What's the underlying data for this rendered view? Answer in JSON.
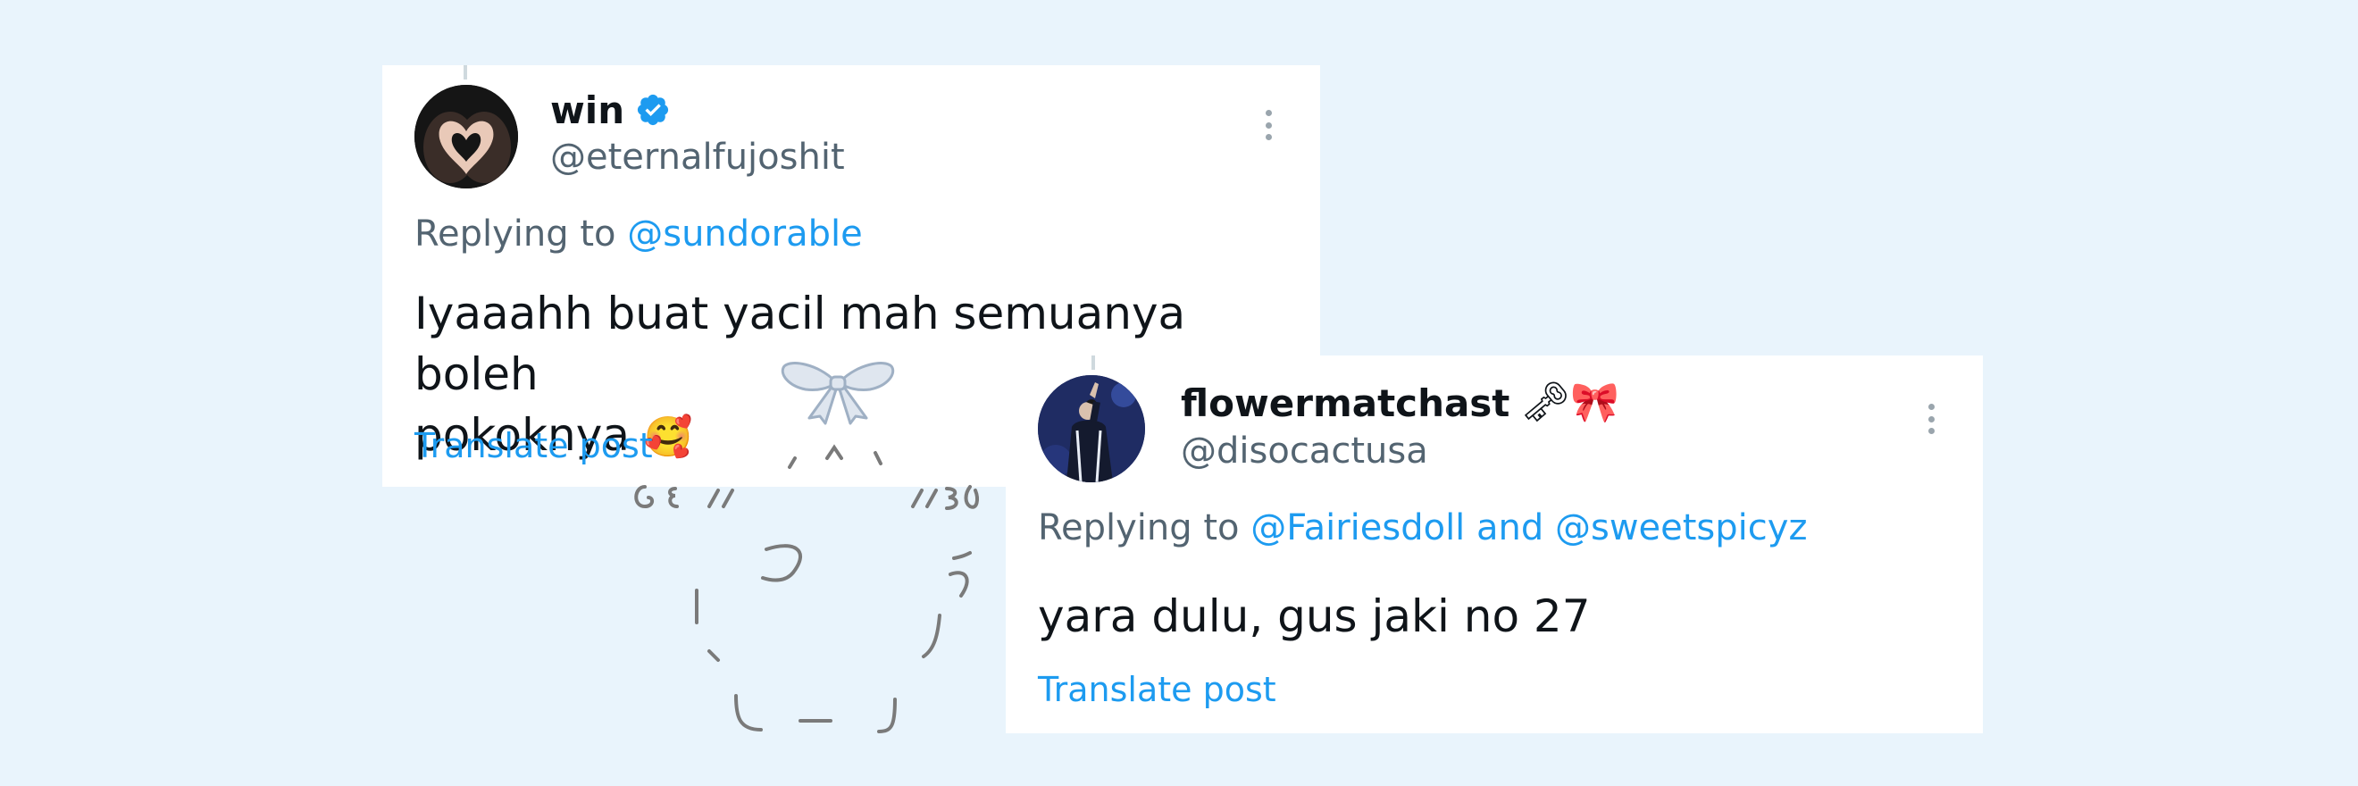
{
  "posts": [
    {
      "display_name": "win",
      "handle": "@eternalfujoshit",
      "verified": true,
      "replying_to_prefix": "Replying to",
      "replying_to": "@sundorable",
      "text_line1": "Iyaaahh buat yacil mah semuanya boleh",
      "text_line2": "pokoknya",
      "text_emoji": "🥰",
      "translate_label": "Translate post"
    },
    {
      "display_name": "flowermatchast",
      "name_emojis": "🗝🎀",
      "handle": "@disocactusa",
      "replying_to_prefix": "Replying to",
      "replying_to": "@Fairiesdoll and @sweetspicyz",
      "text": "yara dulu, gus jaki no 27",
      "translate_label": "Translate post"
    }
  ],
  "decor": {
    "bow_icon": "ribbon-bow",
    "kaomoji_glyphs": [
      "´ ^ `",
      "6ε //",
      "//3",
      "つ",
      "う",
      "し — J"
    ]
  },
  "colors": {
    "background": "#e9f4fc",
    "link": "#1d9bf0",
    "secondary_text": "#536471",
    "primary_text": "#0f1419",
    "verified_badge": "#1d9bf0"
  }
}
